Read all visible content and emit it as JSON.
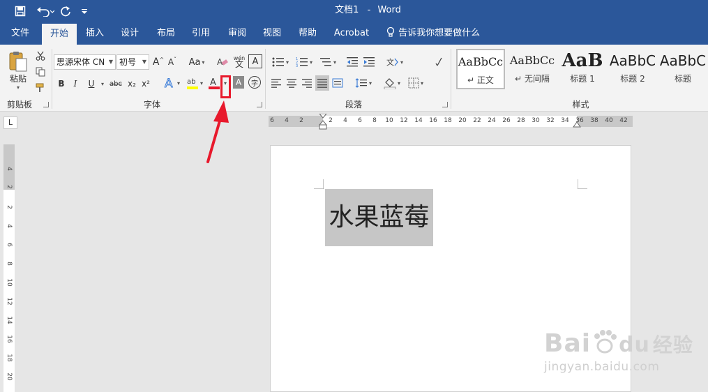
{
  "window": {
    "doc_name": "文档1",
    "separator": "-",
    "app_name": "Word"
  },
  "quick_access": {
    "save_icon": "save-icon",
    "undo_icon": "undo-icon",
    "redo_icon": "redo-icon",
    "customize_icon": "customize-icon"
  },
  "tabs": [
    {
      "label": "文件",
      "active": false
    },
    {
      "label": "开始",
      "active": true
    },
    {
      "label": "插入",
      "active": false
    },
    {
      "label": "设计",
      "active": false
    },
    {
      "label": "布局",
      "active": false
    },
    {
      "label": "引用",
      "active": false
    },
    {
      "label": "审阅",
      "active": false
    },
    {
      "label": "视图",
      "active": false
    },
    {
      "label": "帮助",
      "active": false
    },
    {
      "label": "Acrobat",
      "active": false
    }
  ],
  "tell_me": "告诉我你想要做什么",
  "clipboard": {
    "paste_label": "粘贴",
    "group_label": "剪贴板"
  },
  "font": {
    "font_name": "思源宋体 CN",
    "font_size": "初号",
    "case_label": "Aa",
    "phonetic_label": "wén",
    "bold": "B",
    "italic": "I",
    "underline": "U",
    "strike": "abc",
    "subscript": "x₂",
    "superscript": "x²",
    "group_label": "字体"
  },
  "paragraph": {
    "group_label": "段落"
  },
  "styles": {
    "group_label": "样式",
    "items": [
      {
        "preview": "AaBbCc",
        "name": "正文",
        "selected": true
      },
      {
        "preview": "AaBbCc",
        "name": "无间隔",
        "selected": false
      },
      {
        "preview": "AaB",
        "name": "标题 1",
        "selected": false
      },
      {
        "preview": "AaBbC",
        "name": "标题 2",
        "selected": false
      },
      {
        "preview": "AaBbC",
        "name": "标题",
        "selected": false
      }
    ]
  },
  "ruler": {
    "corner": "L",
    "h_ticks": [
      "6",
      "4",
      "2",
      "2",
      "4",
      "6",
      "8",
      "10",
      "12",
      "14",
      "16",
      "18",
      "20",
      "22",
      "24",
      "26",
      "28",
      "30",
      "32",
      "34",
      "36",
      "38",
      "40",
      "42"
    ],
    "v_ticks": [
      "4",
      "2",
      "2",
      "4",
      "6",
      "8",
      "10",
      "12",
      "14",
      "16",
      "18",
      "20"
    ]
  },
  "document": {
    "text": "水果蓝莓"
  },
  "annotation": {
    "color": "#e8192c"
  },
  "watermark": {
    "brand": "Bai",
    "brand_tail": "经验",
    "site": "jingyan.baidu.com"
  },
  "colors": {
    "accent": "#2b579a",
    "ribbon_bg": "#f3f3f3",
    "highlight": "#ffff00",
    "font_color_red": "#e8192c"
  }
}
